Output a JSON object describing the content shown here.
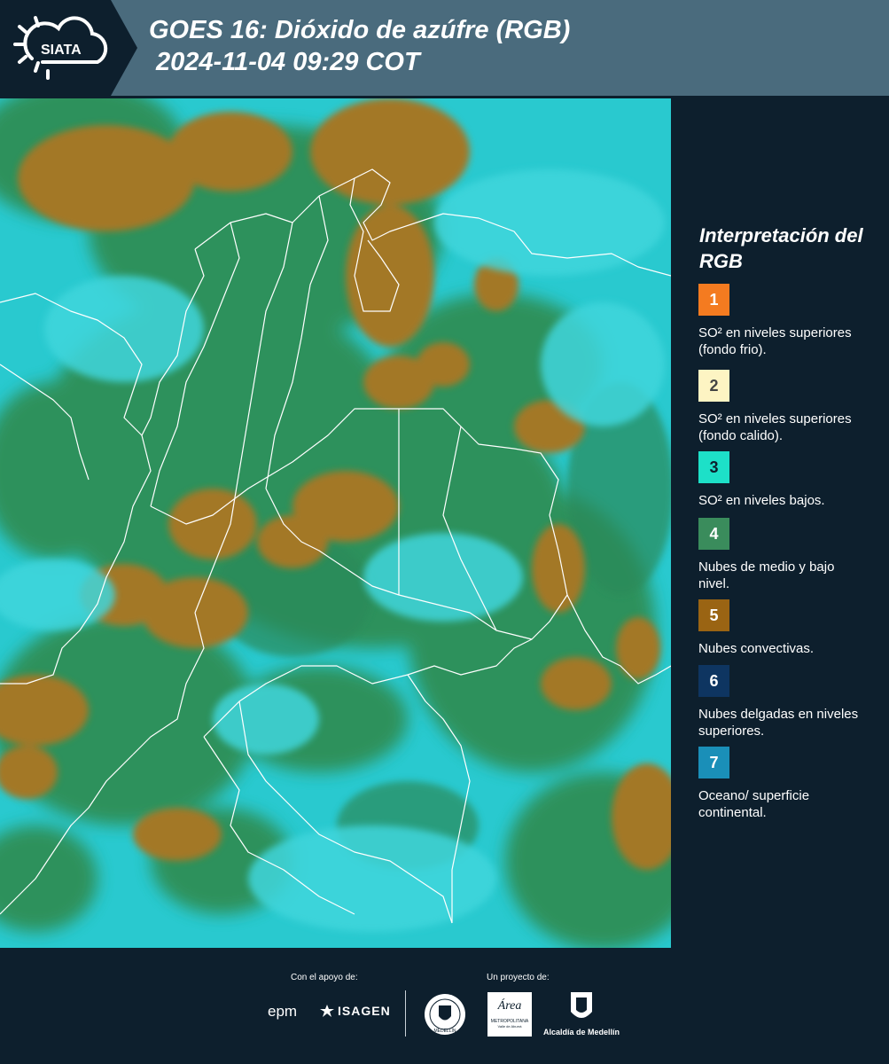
{
  "header": {
    "logo_text": "SIATA",
    "title_line1": "GOES 16: Dióxido de azúfre (RGB)",
    "title_line2": "2024-11-04 09:29 COT"
  },
  "legend": {
    "title": "Interpretación del RGB",
    "items": [
      {
        "number": "1",
        "label": "SO² en niveles superiores (fondo frio).",
        "color": "#f47b20"
      },
      {
        "number": "2",
        "label": "SO² en niveles superiores (fondo calido).",
        "color": "#fdf4c3"
      },
      {
        "number": "3",
        "label": "SO² en niveles bajos.",
        "color": "#1de0c8"
      },
      {
        "number": "4",
        "label": "Nubes de medio y bajo nivel.",
        "color": "#3a8c5c"
      },
      {
        "number": "5",
        "label": "Nubes convectivas.",
        "color": "#9a6413"
      },
      {
        "number": "6",
        "label": "Nubes delgadas en niveles superiores.",
        "color": "#0e3561"
      },
      {
        "number": "7",
        "label": "Oceano/ superficie continental.",
        "color": "#1a8fb8"
      }
    ]
  },
  "footer": {
    "support_label": "Con el apoyo de:",
    "project_label": "Un proyecto de:",
    "sponsor_1": "epm",
    "sponsor_2": "ISAGEN",
    "partner_1": "MEDELLÍN",
    "partner_2_name": "Área",
    "partner_2_sub": "METROPOLITANA",
    "partner_2_sub2": "Valle de Aburrá",
    "partner_3": "Alcaldía de Medellín"
  },
  "colors": {
    "background": "#0d1f2d",
    "header_band": "#4a6b7d",
    "map_cyan": "#29c9cf",
    "map_green": "#2f8f56",
    "map_brown": "#a37825"
  }
}
